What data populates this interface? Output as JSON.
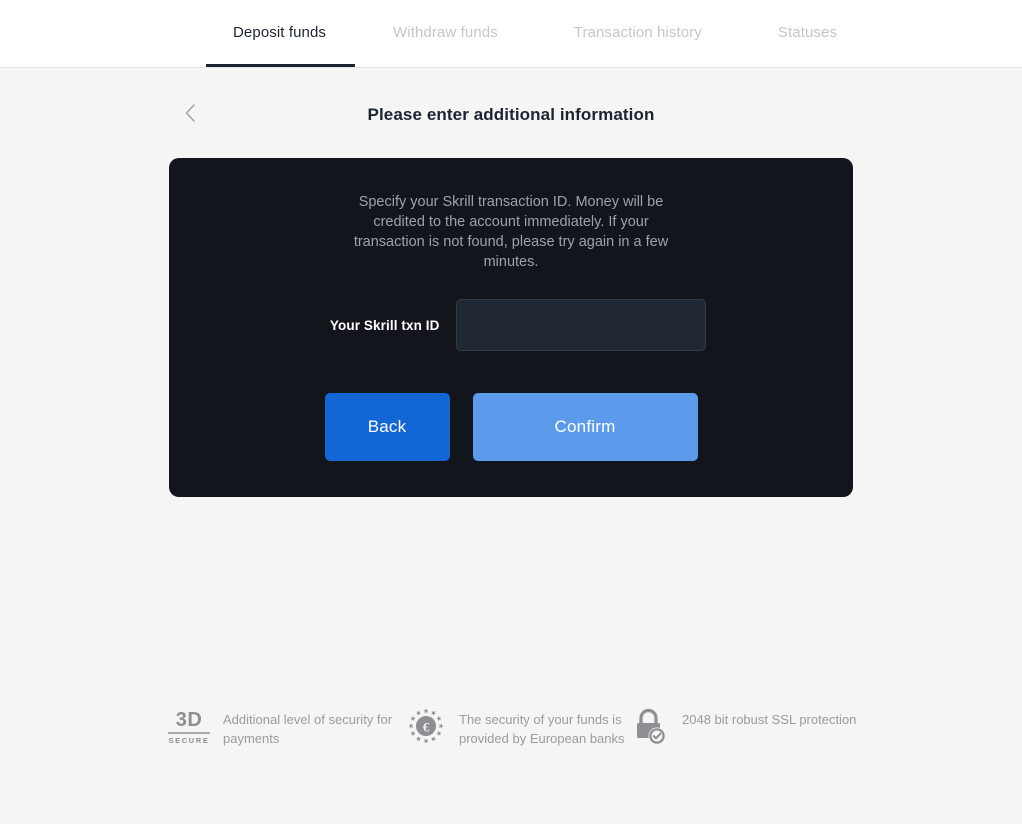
{
  "tabs": [
    {
      "label": "Deposit funds",
      "active": true
    },
    {
      "label": "Withdraw funds",
      "active": false
    },
    {
      "label": "Transaction history",
      "active": false
    },
    {
      "label": "Statuses",
      "active": false
    }
  ],
  "header": {
    "back_icon": "chevron-left-icon",
    "title": "Please enter additional information"
  },
  "card": {
    "description": "Specify your Skrill transaction ID. Money will be credited to the account immediately. If your transaction is not found, please try again in a few minutes.",
    "field": {
      "label": "Your Skrill txn ID",
      "value": "",
      "placeholder": ""
    },
    "buttons": {
      "back": "Back",
      "confirm": "Confirm"
    },
    "colors": {
      "card_bg": "#12151b",
      "input_bg": "#1f2733",
      "back_btn": "#1266d6",
      "confirm_btn": "#5c9bec"
    }
  },
  "footer": {
    "badges": [
      {
        "icon": "3d-secure-icon",
        "logo_top": "3D",
        "logo_bottom": "SECURE",
        "text": "Additional level of security for payments"
      },
      {
        "icon": "euro-stars-icon",
        "symbol": "€",
        "text": "The security of your funds is provided by European banks"
      },
      {
        "icon": "lock-check-icon",
        "text": "2048 bit robust SSL protection"
      }
    ]
  }
}
